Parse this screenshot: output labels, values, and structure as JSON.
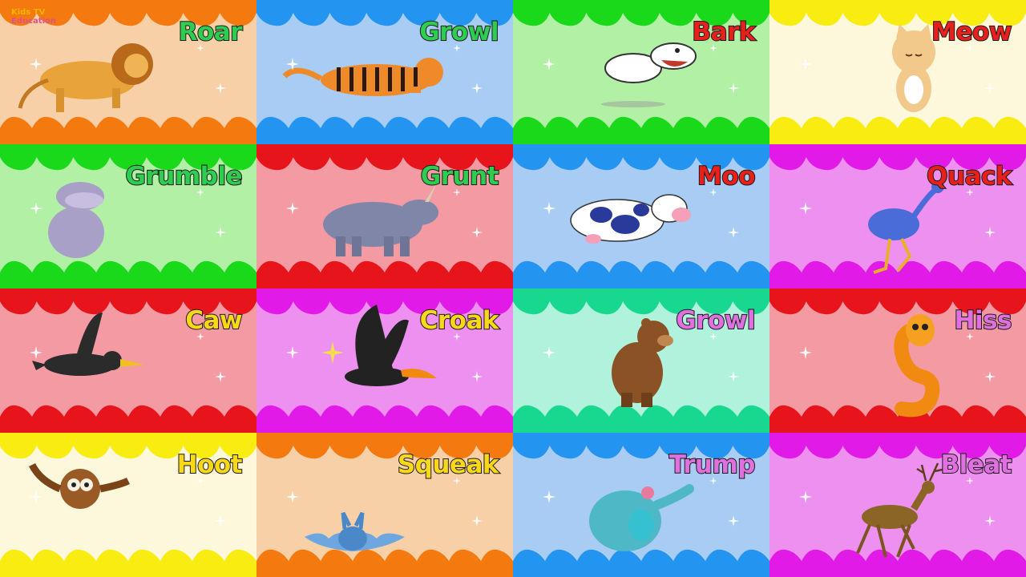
{
  "logo": {
    "line1": "Kids TV",
    "line2": "Education"
  },
  "tiles": [
    {
      "word": "Roar",
      "word_color": "#2ecc4f",
      "bg": "#f8d0a8",
      "drip": "#f47a10",
      "animal": "lion-icon"
    },
    {
      "word": "Growl",
      "word_color": "#2ecc4f",
      "bg": "#a8ccf4",
      "drip": "#2394f0",
      "animal": "tiger-icon"
    },
    {
      "word": "Bark",
      "word_color": "#e8201c",
      "bg": "#b2f0a6",
      "drip": "#1ad81a",
      "animal": "dog-icon"
    },
    {
      "word": "Meow",
      "word_color": "#e8201c",
      "bg": "#fdf8dc",
      "drip": "#f8ec10",
      "animal": "cat-icon"
    },
    {
      "word": "Grumble",
      "word_color": "#2ecc4f",
      "bg": "#b2f0a6",
      "drip": "#1ad81a",
      "animal": "hippo-icon"
    },
    {
      "word": "Grunt",
      "word_color": "#2ecc4f",
      "bg": "#f49aa2",
      "drip": "#e8141c",
      "animal": "rhino-icon"
    },
    {
      "word": "Moo",
      "word_color": "#e8201c",
      "bg": "#a8ccf4",
      "drip": "#2394f0",
      "animal": "cow-icon"
    },
    {
      "word": "Quack",
      "word_color": "#e8201c",
      "bg": "#ee90f0",
      "drip": "#e21ae8",
      "animal": "ostrich-icon"
    },
    {
      "word": "Caw",
      "word_color": "#f8d818",
      "bg": "#f49aa2",
      "drip": "#e8141c",
      "animal": "crow-icon"
    },
    {
      "word": "Croak",
      "word_color": "#f8d818",
      "bg": "#ee90f0",
      "drip": "#e21ae8",
      "animal": "toucan-icon"
    },
    {
      "word": "Growl",
      "word_color": "#e070e0",
      "bg": "#b0f2dc",
      "drip": "#18d890",
      "animal": "bear-icon"
    },
    {
      "word": "Hiss",
      "word_color": "#e070e0",
      "bg": "#f49aa2",
      "drip": "#e8141c",
      "animal": "snake-icon"
    },
    {
      "word": "Hoot",
      "word_color": "#f8d818",
      "bg": "#fdf8dc",
      "drip": "#f8ec10",
      "animal": "owl-icon"
    },
    {
      "word": "Squeak",
      "word_color": "#f8d818",
      "bg": "#f8d0a8",
      "drip": "#f47a10",
      "animal": "bat-icon"
    },
    {
      "word": "Trump",
      "word_color": "#e070e0",
      "bg": "#a8ccf4",
      "drip": "#2394f0",
      "animal": "elephant-icon"
    },
    {
      "word": "Bleat",
      "word_color": "#e070e0",
      "bg": "#ee90f0",
      "drip": "#e21ae8",
      "animal": "deer-icon"
    }
  ]
}
